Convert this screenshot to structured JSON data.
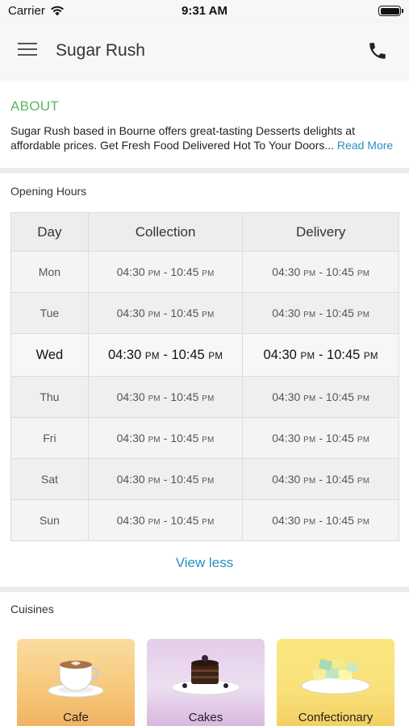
{
  "status_bar": {
    "carrier": "Carrier",
    "time": "9:31 AM"
  },
  "nav": {
    "title": "Sugar Rush"
  },
  "about": {
    "title": "ABOUT",
    "text": "Sugar Rush based in Bourne offers great-tasting Desserts delights at affordable prices. Get Fresh Food Delivered Hot To Your Doors...",
    "read_more": " Read More"
  },
  "hours": {
    "title": "Opening Hours",
    "headers": [
      "Day",
      "Collection",
      "Delivery"
    ],
    "rows": [
      {
        "day": "Mon",
        "col_open": "04:30",
        "col_close": "10:45",
        "del_open": "04:30",
        "del_close": "10:45"
      },
      {
        "day": "Tue",
        "col_open": "04:30",
        "col_close": "10:45",
        "del_open": "04:30",
        "del_close": "10:45"
      },
      {
        "day": "Wed",
        "col_open": "04:30",
        "col_close": "10:45",
        "del_open": "04:30",
        "del_close": "10:45"
      },
      {
        "day": "Thu",
        "col_open": "04:30",
        "col_close": "10:45",
        "del_open": "04:30",
        "del_close": "10:45"
      },
      {
        "day": "Fri",
        "col_open": "04:30",
        "col_close": "10:45",
        "del_open": "04:30",
        "del_close": "10:45"
      },
      {
        "day": "Sat",
        "col_open": "04:30",
        "col_close": "10:45",
        "del_open": "04:30",
        "del_close": "10:45"
      },
      {
        "day": "Sun",
        "col_open": "04:30",
        "col_close": "10:45",
        "del_open": "04:30",
        "del_close": "10:45"
      }
    ],
    "pm": "PM",
    "dash": " - ",
    "view_less": "View less"
  },
  "cuisines": {
    "title": "Cuisines",
    "items": [
      {
        "label": "Cafe",
        "icon": "coffee-cup-icon"
      },
      {
        "label": "Cakes",
        "icon": "chocolate-cake-icon"
      },
      {
        "label": "Confectionary",
        "icon": "sweets-plate-icon"
      }
    ]
  },
  "colors": {
    "accent_green": "#5cb85c",
    "link_blue": "#2a8fc0"
  }
}
